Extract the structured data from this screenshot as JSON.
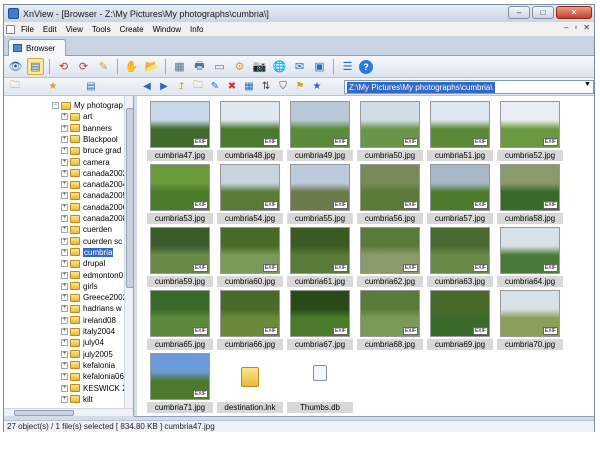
{
  "window": {
    "title": "XnView - [Browser - Z:\\My Pictures\\My photographs\\cumbria\\]"
  },
  "menu": [
    "File",
    "Edit",
    "View",
    "Tools",
    "Create",
    "Window",
    "Info"
  ],
  "tab": {
    "label": "Browser"
  },
  "address": {
    "value": "Z:\\My Pictures\\My photographs\\cumbria\\"
  },
  "tree": {
    "items": [
      {
        "label": "My photograp",
        "expanded": true,
        "selected": false
      },
      {
        "label": "art",
        "expanded": false,
        "selected": false
      },
      {
        "label": "banners",
        "expanded": false,
        "selected": false
      },
      {
        "label": "Blackpool",
        "expanded": false,
        "selected": false
      },
      {
        "label": "bruce grad",
        "expanded": false,
        "selected": false
      },
      {
        "label": "camera",
        "expanded": false,
        "selected": false
      },
      {
        "label": "canada2002",
        "expanded": false,
        "selected": false
      },
      {
        "label": "canada2004",
        "expanded": false,
        "selected": false
      },
      {
        "label": "canada2005",
        "expanded": false,
        "selected": false
      },
      {
        "label": "canada2006",
        "expanded": false,
        "selected": false
      },
      {
        "label": "canada2008",
        "expanded": false,
        "selected": false
      },
      {
        "label": "cuerden",
        "expanded": false,
        "selected": false
      },
      {
        "label": "cuerden sc",
        "expanded": false,
        "selected": false
      },
      {
        "label": "cumbria",
        "expanded": false,
        "selected": true
      },
      {
        "label": "drupal",
        "expanded": false,
        "selected": false
      },
      {
        "label": "edmonton0",
        "expanded": false,
        "selected": false
      },
      {
        "label": "girls",
        "expanded": false,
        "selected": false
      },
      {
        "label": "Greece2002",
        "expanded": false,
        "selected": false
      },
      {
        "label": "hadrians w",
        "expanded": false,
        "selected": false
      },
      {
        "label": "ireland08",
        "expanded": false,
        "selected": false
      },
      {
        "label": "italy2004",
        "expanded": false,
        "selected": false
      },
      {
        "label": "july04",
        "expanded": false,
        "selected": false
      },
      {
        "label": "july2005",
        "expanded": false,
        "selected": false
      },
      {
        "label": "kefalonia",
        "expanded": false,
        "selected": false
      },
      {
        "label": "kefalonia06",
        "expanded": false,
        "selected": false
      },
      {
        "label": "KESWICK 2",
        "expanded": false,
        "selected": false
      },
      {
        "label": "kilt",
        "expanded": false,
        "selected": false
      }
    ]
  },
  "thumbnails": [
    {
      "name": "cumbria47.jpg",
      "sky": "#c8d8e8",
      "ground": "#3f6a2a"
    },
    {
      "name": "cumbria48.jpg",
      "sky": "#dfe7ef",
      "ground": "#4a7a2e"
    },
    {
      "name": "cumbria49.jpg",
      "sky": "#b8c8d8",
      "ground": "#5a8a3a"
    },
    {
      "name": "cumbria50.jpg",
      "sky": "#d0dce8",
      "ground": "#6a9448"
    },
    {
      "name": "cumbria51.jpg",
      "sky": "#dce6f0",
      "ground": "#5a8a36"
    },
    {
      "name": "cumbria52.jpg",
      "sky": "#e8eef4",
      "ground": "#6a9a40"
    },
    {
      "name": "cumbria53.jpg",
      "sky": "#6a9a3a",
      "ground": "#4a7a2a"
    },
    {
      "name": "cumbria54.jpg",
      "sky": "#c8d4dc",
      "ground": "#5a7a3a"
    },
    {
      "name": "cumbria55.jpg",
      "sky": "#bccadc",
      "ground": "#6a7a4a"
    },
    {
      "name": "cumbria56.jpg",
      "sky": "#7a8a5a",
      "ground": "#5a7a3a"
    },
    {
      "name": "cumbria57.jpg",
      "sky": "#a8b8c8",
      "ground": "#4a7a2a"
    },
    {
      "name": "cumbria58.jpg",
      "sky": "#8a9a6a",
      "ground": "#3a6a2a"
    },
    {
      "name": "cumbria59.jpg",
      "sky": "#3a5a2a",
      "ground": "#6a8a4a"
    },
    {
      "name": "cumbria60.jpg",
      "sky": "#4a6a2a",
      "ground": "#7a9a5a"
    },
    {
      "name": "cumbria61.jpg",
      "sky": "#3a5a22",
      "ground": "#5a7a3a"
    },
    {
      "name": "cumbria62.jpg",
      "sky": "#5a7a3a",
      "ground": "#8a9a6a"
    },
    {
      "name": "cumbria63.jpg",
      "sky": "#4a6a32",
      "ground": "#6a8a4a"
    },
    {
      "name": "cumbria64.jpg",
      "sky": "#d8e0e8",
      "ground": "#4a7a3a"
    },
    {
      "name": "cumbria65.jpg",
      "sky": "#3a6a2a",
      "ground": "#5a8a3a"
    },
    {
      "name": "cumbria66.jpg",
      "sky": "#4a6a2a",
      "ground": "#6a8a3a"
    },
    {
      "name": "cumbria67.jpg",
      "sky": "#2a4a1a",
      "ground": "#4a7a2a"
    },
    {
      "name": "cumbria68.jpg",
      "sky": "#5a7a3a",
      "ground": "#7a9a5a"
    },
    {
      "name": "cumbria69.jpg",
      "sky": "#4a6a2a",
      "ground": "#3a6a2a"
    },
    {
      "name": "cumbria70.jpg",
      "sky": "#d8e0e8",
      "ground": "#8aa05a"
    },
    {
      "name": "cumbria71.jpg",
      "sky": "#6a9ad8",
      "ground": "#4a7a2a"
    }
  ],
  "extra_items": [
    {
      "name": "destination.lnk",
      "icon": "folder-shortcut-icon"
    },
    {
      "name": "Thumbs.db",
      "icon": "database-file-icon"
    }
  ],
  "status": {
    "text": "27 object(s) / 1 file(s) selected  [ 834.80 KB ]    cumbria47.jpg"
  }
}
